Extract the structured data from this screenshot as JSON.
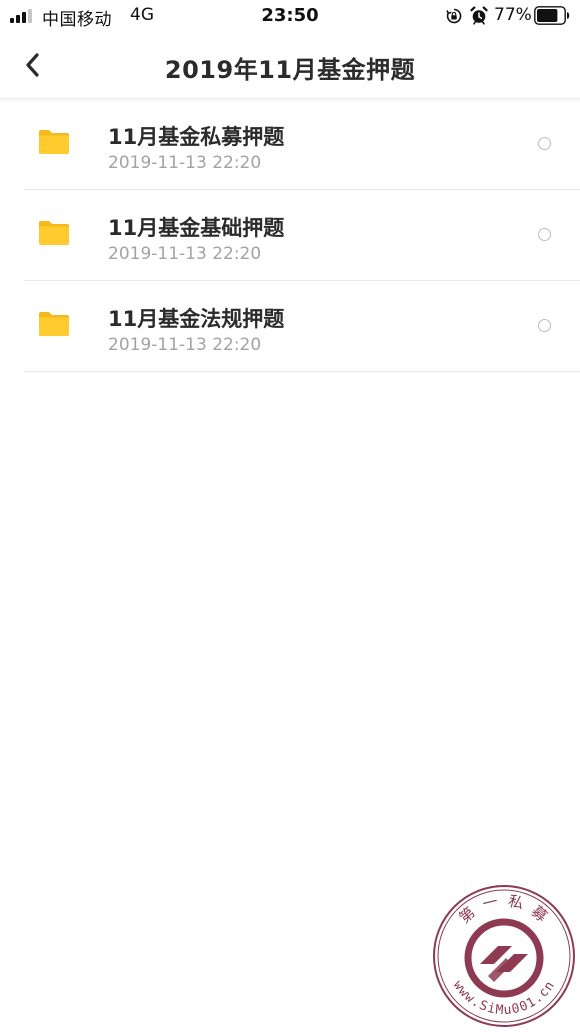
{
  "status_bar": {
    "carrier": "中国移动",
    "network": "4G",
    "time": "23:50",
    "battery_percent": "77%",
    "battery_level": 0.77,
    "icons": [
      "signal-icon",
      "orientation-lock-icon",
      "alarm-icon",
      "battery-icon"
    ]
  },
  "nav": {
    "back_icon": "chevron-left-icon",
    "title": "2019年11月基金押题"
  },
  "files": [
    {
      "icon": "folder-icon",
      "name": "11月基金私募押题",
      "date": "2019-11-13 22:20"
    },
    {
      "icon": "folder-icon",
      "name": "11月基金基础押题",
      "date": "2019-11-13 22:20"
    },
    {
      "icon": "folder-icon",
      "name": "11月基金法规押题",
      "date": "2019-11-13 22:20"
    }
  ],
  "watermark": {
    "top_text": "第 一 私 募",
    "bottom_text": "www.SiMu001.cn"
  },
  "colors": {
    "folder": "#ffcb2f",
    "folder_tab": "#f5b919",
    "watermark": "#8e3a52",
    "date_text": "#a3a3a3"
  }
}
